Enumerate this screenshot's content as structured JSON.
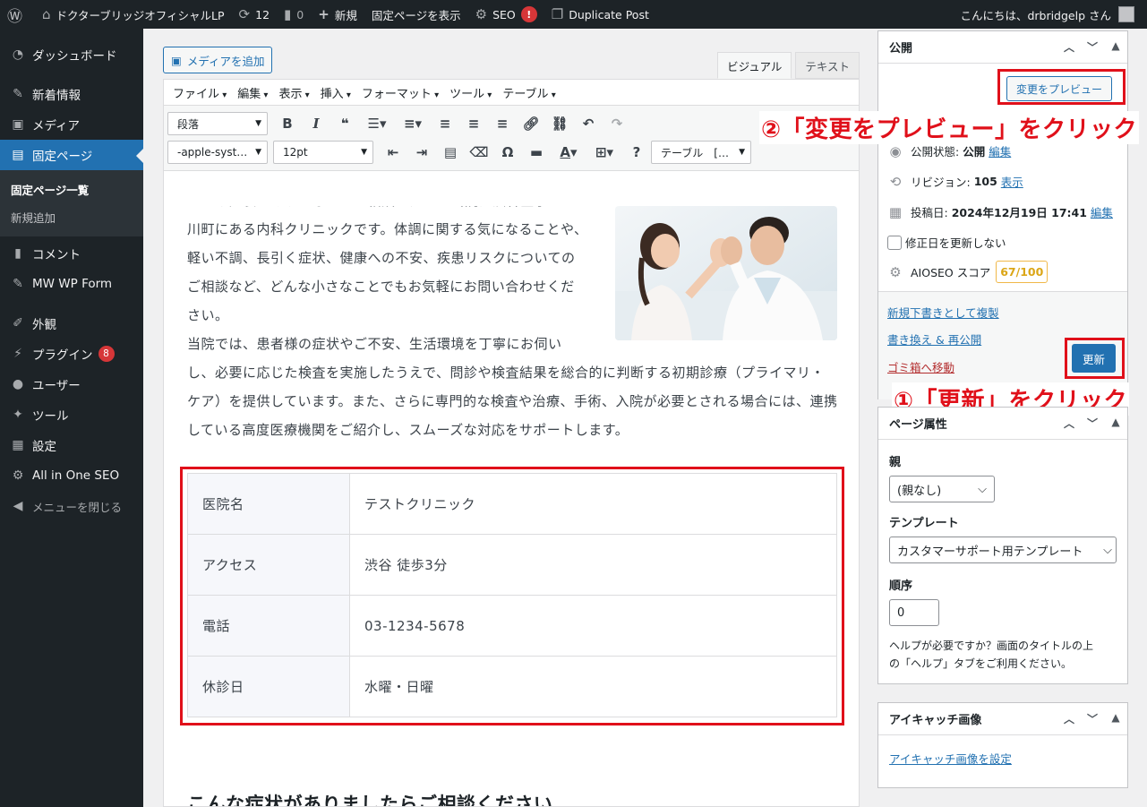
{
  "adminbar": {
    "site_name": "ドクターブリッジオフィシャルLP",
    "updates_count": "12",
    "comments_count": "0",
    "new_label": "新規",
    "view_page_label": "固定ページを表示",
    "seo_label": "SEO",
    "seo_alert": "!",
    "duplicate_label": "Duplicate Post",
    "greeting": "こんにちは、drbridgelp さん"
  },
  "sidebar": {
    "items": [
      {
        "label": "ダッシュボード"
      },
      {
        "label": "新着情報"
      },
      {
        "label": "メディア"
      },
      {
        "label": "固定ページ"
      },
      {
        "label": "コメント"
      },
      {
        "label": "MW WP Form"
      },
      {
        "label": "外観"
      },
      {
        "label": "プラグイン",
        "badge": "8"
      },
      {
        "label": "ユーザー"
      },
      {
        "label": "ツール"
      },
      {
        "label": "設定"
      },
      {
        "label": "All in One SEO"
      },
      {
        "label": "メニューを閉じる"
      }
    ],
    "submenu": [
      "固定ページ一覧",
      "新規追加"
    ]
  },
  "editor": {
    "add_media": "メディアを追加",
    "tab_visual": "ビジュアル",
    "tab_text": "テキスト",
    "menubar": [
      "ファイル",
      "編集",
      "表示",
      "挿入",
      "フォーマット",
      "ツール",
      "テーブル"
    ],
    "format_select": "段落",
    "font_select": "-apple-syst…",
    "size_select": "12pt",
    "table_select": "テーブル　[…",
    "paragraph1": [
      "こんな症状がありましたらご相談ください当院は渋谷区宇た",
      "川町にある内科クリニックです。体調に関する気になることや、",
      "軽い不調、長引く症状、健康への不安、疾患リスクについての",
      "ご相談など、どんな小さなことでもお気軽にお問い合わせくだ",
      "さい。"
    ],
    "paragraph2": [
      "当院では、患者様の症状やご不安、生活環境を丁寧にお伺い",
      "し、必要に応じた検査を実施したうえで、問診や検査結果を総合的に判断する初期診療（プライマリ・",
      "ケア）を提供しています。また、さらに専門的な検査や治療、手術、入院が必要とされる場合には、連携",
      "している高度医療機関をご紹介し、スムーズな対応をサポートします。"
    ],
    "table": [
      {
        "label": "医院名",
        "value": "テストクリニック"
      },
      {
        "label": "アクセス",
        "value": "渋谷 徒歩3分"
      },
      {
        "label": "電話",
        "value": "03-1234-5678"
      },
      {
        "label": "休診日",
        "value": "水曜・日曜"
      }
    ],
    "heading": "こんな症状がありましたらご相談ください"
  },
  "publish": {
    "title": "公開",
    "preview_button": "変更をプレビュー",
    "status_label": "公開状態:",
    "status_value": "公開",
    "edit_link": "編集",
    "revisions_label": "リビジョン:",
    "revisions_value": "105",
    "show_link": "表示",
    "date_label": "投稿日:",
    "date_value": "2024年12月19日 17:41",
    "no_update_date": "修正日を更新しない",
    "aioseo_label": "AIOSEO スコア",
    "aioseo_score": "67/100",
    "copy_draft": "新規下書きとして複製",
    "rewrite": "書き換え & 再公開",
    "trash": "ゴミ箱へ移動",
    "update_button": "更新"
  },
  "annotations": {
    "step2": "②「変更をプレビュー」をクリック",
    "step1": "①「更新」をクリック"
  },
  "page_attributes": {
    "title": "ページ属性",
    "parent_label": "親",
    "parent_value": "(親なし)",
    "template_label": "テンプレート",
    "template_value": "カスタマーサポート用テンプレート",
    "order_label": "順序",
    "order_value": "0",
    "help_text_1": "ヘルプが必要ですか？画面のタイトルの上",
    "help_text_2": "の「ヘルプ」タブをご利用ください。"
  },
  "featured_image": {
    "title": "アイキャッチ画像",
    "set_link": "アイキャッチ画像を設定"
  },
  "colors": {
    "admin_dark": "#1d2327",
    "accent_blue": "#2271b1",
    "annotation_red": "#e0101a",
    "score_orange": "#dba617"
  }
}
